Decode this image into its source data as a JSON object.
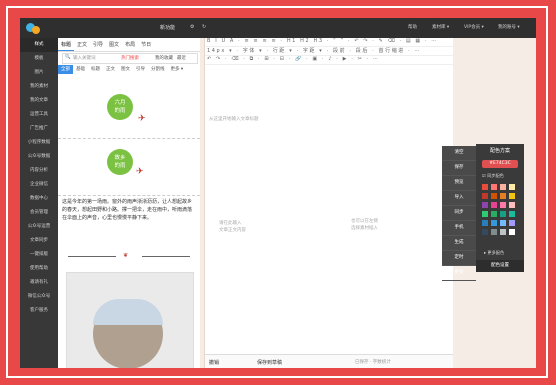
{
  "topbar": {
    "title": "新功能",
    "links": [
      "帮助",
      "素材库 ▾",
      "VIP会员 ▾",
      "我的账号 ▾"
    ]
  },
  "leftnav": {
    "items": [
      "样式",
      "模板",
      "图片",
      "我的素材",
      "我的文章",
      "运营工具",
      "广告推广",
      "小程序数据",
      "公众号数据",
      "内容分析",
      "企业微信",
      "数据中心",
      "会员管理",
      "公众号运营",
      "文章同步",
      "一键排版",
      "使用帮助",
      "邀请有礼",
      "微信公众号",
      "客户服务"
    ]
  },
  "material": {
    "tabs": [
      "标题",
      "正文",
      "引导",
      "图文",
      "布局",
      "节日"
    ],
    "search": {
      "placeholder": "输入关键词",
      "link1": "热门搜索",
      "link2": "我的收藏",
      "link3": "最近"
    },
    "cat_tabs": [
      "全部",
      "基础",
      "标题",
      "正文",
      "图文",
      "引导",
      "分割线",
      "更多 ▾"
    ],
    "card1_text": [
      "六月",
      "的雨"
    ],
    "card2_text": [
      "故乡",
      "的雨"
    ],
    "paragraph": "这是今年的第一场雨。窗外的雨声淅淅沥沥，让人想起故乡的春天，想起田野和小路。撑一把伞，走在雨中，听雨滴落在伞面上的声音，心里也慢慢平静下来。"
  },
  "editor": {
    "toolbar_rows": [
      "B I U A · ≡ ≡ ≡ ≡ · H1 H2 H3 · “ ” · ↶ ↷ · ✎ ⌫ · ▤ ▦ · ⋯",
      "14px ▾ · 字体 ▾ · 行距 ▾ · 字距 ▾ · 段前 · 段后 · 首行缩进 · ⋯",
      "↶ ↷ · ⌫ · ⧉ · ⊞ · ⊟ · 🔗 · ▣ · ♪ · ▶ · ✂ · ⋯"
    ],
    "placeholder_top": "从这里开始输入文章标题",
    "placeholder_left": [
      "请在此输入",
      "文章正文内容"
    ],
    "placeholder_right": [
      "也可以在左侧",
      "选择素材插入"
    ],
    "status_undo": "撤销",
    "status_save": "保存到草稿",
    "status_info": "已保存 · 字数统计"
  },
  "actions": {
    "items": [
      "清空",
      "保存",
      "预览",
      "导入",
      "同步",
      "手机",
      "生成",
      "定时",
      "更多"
    ]
  },
  "palette": {
    "title": "配色方案",
    "hex": "#E74C3C",
    "check_label": "同步配色",
    "more_label": "▸ 更多配色",
    "button": "配色设置",
    "swatches": [
      "#e74c3c",
      "#ff7675",
      "#fab1a0",
      "#ffeaa7",
      "#c0392b",
      "#d35400",
      "#e67e22",
      "#f1c40f",
      "#8e44ad",
      "#e84393",
      "#fd79a8",
      "#ffbebe",
      "#2ecc71",
      "#27ae60",
      "#16a085",
      "#1abc9c",
      "#2980b9",
      "#3498db",
      "#74b9ff",
      "#a29bfe",
      "#34495e",
      "#7f8c8d",
      "#bdc3c7",
      "#ffffff"
    ]
  }
}
